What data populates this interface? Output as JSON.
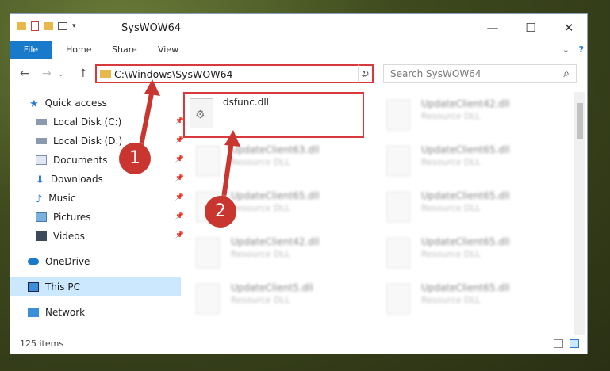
{
  "window": {
    "title": "SysWOW64",
    "minimize": "—",
    "maximize": "☐",
    "close": "✕"
  },
  "ribbon": {
    "tabs": [
      "File",
      "Home",
      "Share",
      "View"
    ]
  },
  "navigation": {
    "back": "←",
    "forward": "→",
    "up": "↑"
  },
  "address": {
    "path": "C:\\Windows\\SysWOW64",
    "dropdown": "⌄",
    "refresh": "↻"
  },
  "search": {
    "placeholder": "Search SysWOW64",
    "icon": "⌕"
  },
  "sidebar": {
    "items": [
      {
        "label": "Quick access",
        "icon": "star-icon",
        "pinned": false
      },
      {
        "label": "Local Disk (C:)",
        "icon": "drive-icon",
        "pinned": true
      },
      {
        "label": "Local Disk (D:)",
        "icon": "drive-icon",
        "pinned": true
      },
      {
        "label": "Documents",
        "icon": "documents-icon",
        "pinned": true
      },
      {
        "label": "Downloads",
        "icon": "download-icon",
        "pinned": true
      },
      {
        "label": "Music",
        "icon": "music-icon",
        "pinned": true
      },
      {
        "label": "Pictures",
        "icon": "pictures-icon",
        "pinned": true
      },
      {
        "label": "Videos",
        "icon": "videos-icon",
        "pinned": true
      },
      {
        "label": "OneDrive",
        "icon": "cloud-icon",
        "pinned": false
      },
      {
        "label": "This PC",
        "icon": "pc-icon",
        "pinned": false
      },
      {
        "label": "Network",
        "icon": "network-icon",
        "pinned": false
      }
    ],
    "pin_glyph": "📌"
  },
  "files": {
    "highlighted": {
      "name": "dsfunc.dll",
      "type": ""
    },
    "items": [
      {
        "name": "UpdateClient42.dll",
        "type": "Resource DLL"
      },
      {
        "name": "UpdateClient63.dll",
        "type": "Resource DLL"
      },
      {
        "name": "UpdateClient65.dll",
        "type": "Resource DLL"
      },
      {
        "name": "UpdateClient65.dll",
        "type": "Resource DLL"
      },
      {
        "name": "UpdateClient65.dll",
        "type": "Resource DLL"
      },
      {
        "name": "UpdateClient42.dll",
        "type": "Resource DLL"
      },
      {
        "name": "UpdateClient65.dll",
        "type": "Resource DLL"
      },
      {
        "name": "UpdateClient5.dll",
        "type": "Resource DLL"
      },
      {
        "name": "UpdateClient65.dll",
        "type": "Resource DLL"
      }
    ]
  },
  "status": {
    "count": "125 items"
  },
  "annotations": {
    "step1": "1",
    "step2": "2"
  },
  "colors": {
    "accent": "#1979ca",
    "highlight": "#d9393c",
    "selected": "#cce8ff"
  }
}
